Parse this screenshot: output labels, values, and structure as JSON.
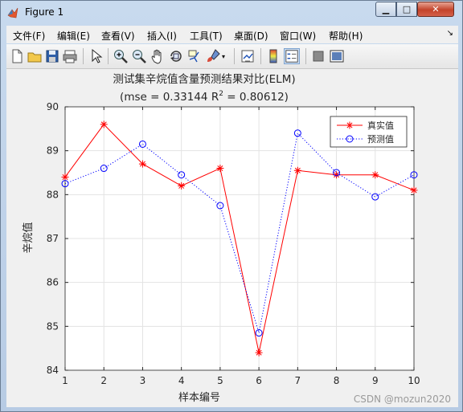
{
  "window": {
    "title": "Figure 1"
  },
  "menu": [
    "文件(F)",
    "编辑(E)",
    "查看(V)",
    "插入(I)",
    "工具(T)",
    "桌面(D)",
    "窗口(W)",
    "帮助(H)"
  ],
  "toolbar_icons": [
    "new-file-icon",
    "open-folder-icon",
    "save-icon",
    "print-icon",
    "pointer-icon",
    "zoom-in-icon",
    "zoom-out-icon",
    "pan-hand-icon",
    "rotate-3d-icon",
    "data-cursor-icon",
    "brush-icon",
    "link-plot-icon",
    "colorbar-icon",
    "legend-icon",
    "hide-plot-tools-icon",
    "show-plot-tools-icon"
  ],
  "chart_data": {
    "type": "line",
    "title": "测试集辛烷值含量预测结果对比(ELM)",
    "subtitle_pre": "(mse = 0.33144 R",
    "subtitle_sup": "2",
    "subtitle_post": " = 0.80612)",
    "xlabel": "样本编号",
    "ylabel": "辛烷值",
    "x": [
      1,
      2,
      3,
      4,
      5,
      6,
      7,
      8,
      9,
      10
    ],
    "xlim": [
      1,
      10
    ],
    "ylim": [
      84,
      90
    ],
    "yticks": [
      84,
      85,
      86,
      87,
      88,
      89,
      90
    ],
    "grid": true,
    "legend_position": "top-right",
    "series": [
      {
        "name": "真实值",
        "color": "#ff0000",
        "marker": "asterisk",
        "linestyle": "solid",
        "values": [
          88.4,
          89.6,
          88.7,
          88.2,
          88.6,
          84.4,
          88.55,
          88.45,
          88.45,
          88.1
        ]
      },
      {
        "name": "预测值",
        "color": "#0000ff",
        "marker": "circle",
        "linestyle": "dotted",
        "values": [
          88.25,
          88.6,
          89.15,
          88.45,
          87.75,
          84.85,
          89.4,
          88.5,
          87.95,
          88.45
        ]
      }
    ]
  },
  "watermark": "CSDN @mozun2020"
}
